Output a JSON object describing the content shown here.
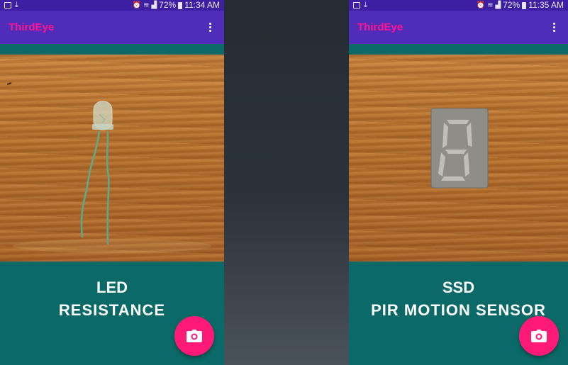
{
  "left_screen": {
    "status": {
      "battery": "72%",
      "time": "11:34 AM"
    },
    "app_title": "ThirdEye",
    "result": {
      "primary": "LED",
      "secondary": "RESISTANCE"
    }
  },
  "right_screen": {
    "status": {
      "battery": "72%",
      "time": "11:35 AM"
    },
    "app_title": "ThirdEye",
    "result": {
      "primary": "SSD",
      "secondary": "PIR MOTION SENSOR"
    }
  },
  "colors": {
    "status_bar": "#3d1fa3",
    "app_bar": "#4f2db8",
    "app_title": "#ff1493",
    "content_background": "#0b6a67",
    "fab": "#ff1a78"
  },
  "icons": {
    "menu": "overflow-menu-icon",
    "fab": "camera-icon",
    "status": [
      "image-icon",
      "download-icon",
      "alarm-icon",
      "wifi-icon",
      "signal-icon",
      "battery-icon"
    ]
  }
}
